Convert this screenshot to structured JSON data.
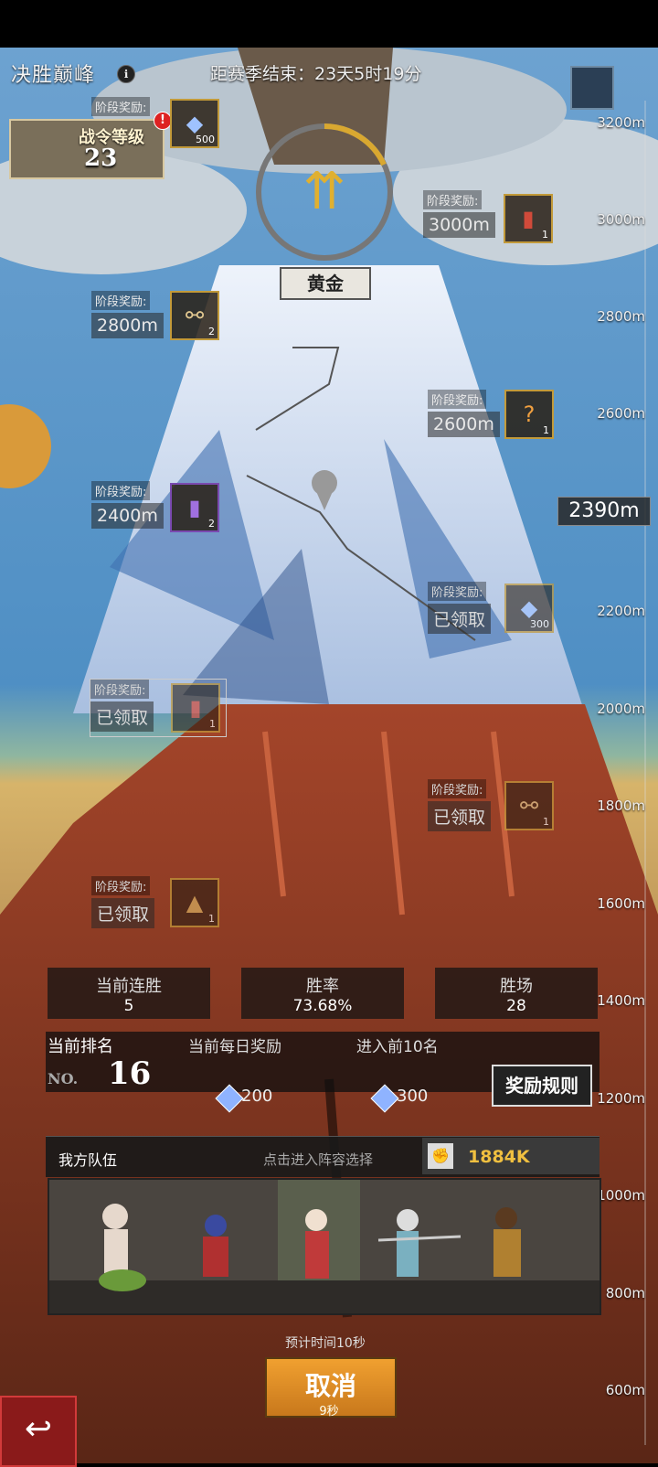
{
  "header": {
    "title": "决胜巅峰",
    "season_countdown": "距赛季结束：23天5时19分"
  },
  "battle_pass": {
    "label": "战令等级",
    "level": "23",
    "alert": "!"
  },
  "tier": {
    "name": "黄金"
  },
  "current_altitude": "2390m",
  "altitude_ticks": [
    "3200m",
    "3000m",
    "2800m",
    "2600m",
    "2200m",
    "2000m",
    "1800m",
    "1600m",
    "1400m",
    "1200m",
    "1000m",
    "800m",
    "600m"
  ],
  "rewards": [
    {
      "label": "阶段奖励:",
      "value": "",
      "count": "500",
      "icon": "gem-icon"
    },
    {
      "label": "阶段奖励:",
      "value": "3000m",
      "count": "1",
      "icon": "book-icon"
    },
    {
      "label": "阶段奖励:",
      "value": "2800m",
      "count": "2",
      "icon": "scroll-icon"
    },
    {
      "label": "阶段奖励:",
      "value": "2600m",
      "count": "1",
      "icon": "mystery-chest-icon"
    },
    {
      "label": "阶段奖励:",
      "value": "2400m",
      "count": "2",
      "icon": "purple-book-icon"
    },
    {
      "label": "阶段奖励:",
      "value": "已领取",
      "count": "300",
      "icon": "gem-icon"
    },
    {
      "label": "阶段奖励:",
      "value": "已领取",
      "count": "1",
      "icon": "book-icon"
    },
    {
      "label": "阶段奖励:",
      "value": "已领取",
      "count": "1",
      "icon": "scroll-icon"
    },
    {
      "label": "阶段奖励:",
      "value": "已领取",
      "count": "1",
      "icon": "chest-icon"
    }
  ],
  "stats": [
    {
      "label": "当前连胜",
      "value": "5"
    },
    {
      "label": "胜率",
      "value": "73.68%"
    },
    {
      "label": "胜场",
      "value": "28"
    }
  ],
  "ranking": {
    "label": "当前排名",
    "prefix": "NO.",
    "value": "16",
    "daily_label": "当前每日奖励",
    "daily_value": "200",
    "top10_label": "进入前10名",
    "top10_value": "300",
    "rules_button": "奖励规则"
  },
  "team": {
    "title": "我方队伍",
    "hint": "点击进入阵容选择",
    "power": "1884K"
  },
  "matching": {
    "eta": "预计时间10秒",
    "cancel_label": "取消",
    "elapsed": "9秒"
  },
  "colors": {
    "sky": "#5a95c8",
    "mountain_snow": "#dfe7f2",
    "mountain_rock": "#8a3a22",
    "accent_gold": "#f0c040",
    "cancel_orange": "#e8962a"
  }
}
